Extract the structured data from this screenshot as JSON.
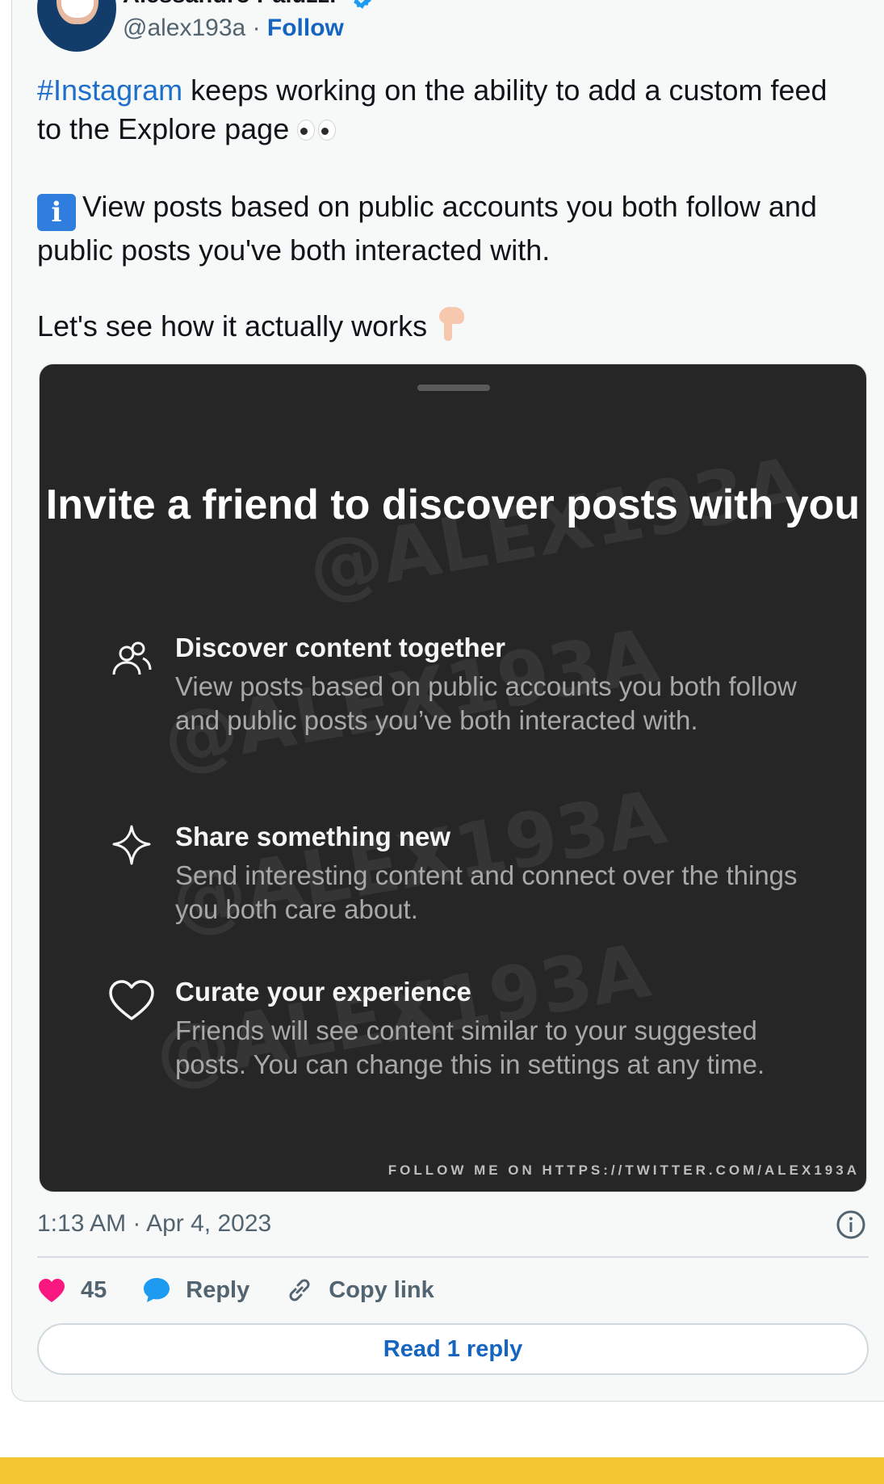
{
  "author": {
    "name_partial": "Alessandro Paluzzi",
    "handle": "@alex193a",
    "separator": " · ",
    "follow_label": "Follow"
  },
  "tweet": {
    "line1_hashtag": "#Instagram",
    "line1_rest": " keeps working on the ability to add a custom feed to the Explore page",
    "info_glyph": "i",
    "line2": "View posts based on public accounts you both follow and public posts you've both interacted with.",
    "line3": "Let's see how it actually works",
    "emoji_icons": [
      "eyes-emoji-icon",
      "info-emoji-icon",
      "pointing-down-emoji-icon"
    ]
  },
  "media": {
    "title": "Invite a friend to discover posts with you",
    "features": [
      {
        "icon": "people-icon",
        "title": "Discover content together",
        "desc": "View posts based on public accounts you both follow and public posts you’ve both interacted with."
      },
      {
        "icon": "sparkle-icon",
        "title": "Share something new",
        "desc": "Send interesting content and connect over the things you both care about."
      },
      {
        "icon": "heart-outline-icon",
        "title": "Curate your experience",
        "desc": "Friends will see content similar to your suggested posts. You can change this in settings at any time."
      }
    ],
    "watermark": "@ALEX193A",
    "footer_note": "FOLLOW ME ON HTTPS://TWITTER.COM/ALEX193A"
  },
  "meta": {
    "timestamp": "1:13 AM · Apr 4, 2023"
  },
  "actions": {
    "like_count": "45",
    "reply_label": "Reply",
    "copy_link_label": "Copy link",
    "read_reply_label": "Read 1 reply"
  },
  "colors": {
    "link_blue": "#1565c0",
    "like_pink": "#f91880",
    "reply_blue": "#1d9bf0",
    "media_bg": "#262626",
    "band_yellow": "#f5c633"
  }
}
